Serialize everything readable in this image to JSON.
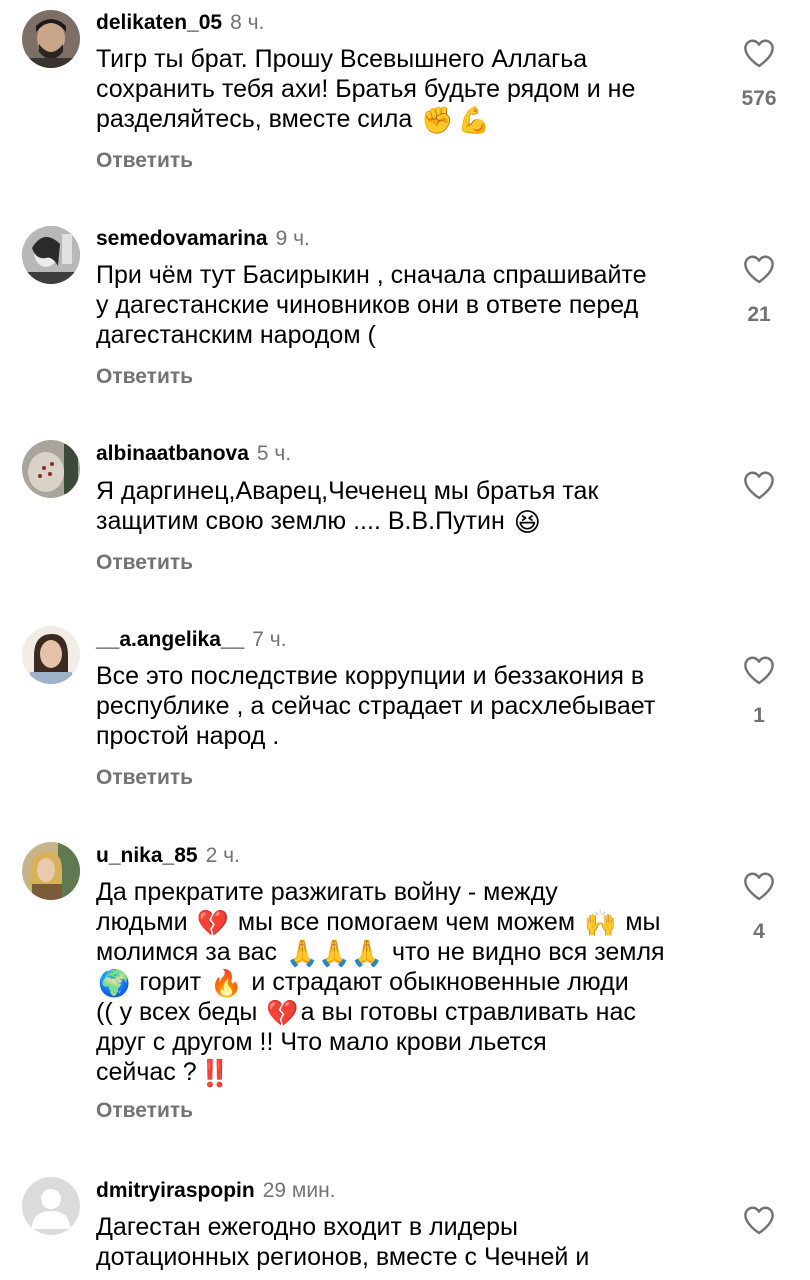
{
  "reply_label": "Ответить",
  "comments": [
    {
      "username": "delikaten_05",
      "time": "8 ч.",
      "lines": [
        "Тигр ты брат. Прошу Всевышнего Аллагьа",
        "сохранить тебя ахи! Братья будьте рядом и не",
        "разделяйтесь, вместе сила"
      ],
      "emojis": [
        "✊",
        "💪"
      ],
      "likes": "576"
    },
    {
      "username": "semedovamarina",
      "time": "9 ч.",
      "lines": [
        "При чём тут Басирыкин , сначала спрашивайте",
        "у дагестанские чиновников  они в ответе перед",
        "дагестанским  народом ("
      ],
      "likes": "21"
    },
    {
      "username": "albinaatbanova",
      "time": "5 ч.",
      "lines": [
        "Я даргинец,Аварец,Чеченец  мы братья так",
        "защитим свою землю .... В.В.Путин"
      ],
      "emojis": [
        "😆"
      ],
      "likes": ""
    },
    {
      "username": "__a.angelika__",
      "time": "7 ч.",
      "lines": [
        "Все это последствие коррупции и беззакония в",
        "республике , а сейчас страдает и расхлебывает",
        "простой народ ."
      ],
      "likes": "1"
    },
    {
      "username": "u_nika_85",
      "time": "2 ч.",
      "text": {
        "l1": "Да прекратите разжигать войну - между",
        "l2a": "людьми",
        "l2b": "мы все помогаем чем можем",
        "l2c": "мы",
        "l3a": "молимся за вас",
        "l3b": "что не видно вся земля",
        "l4a": "горит",
        "l4b": "и страдают обыкновенные люди",
        "l5a": "(( у всех беды",
        "l5b": "а вы готовы стравливать нас",
        "l6": "друг с другом !! Что мало крови льется",
        "l7": "сейчас ?"
      },
      "emojis": {
        "broken_heart": "💔",
        "raised_hands": "🙌",
        "pray": "🙏🙏🙏",
        "globe": "🌍",
        "fire": "🔥",
        "double_exclamation": "‼️"
      },
      "likes": "4"
    },
    {
      "username": "dmitryiraspopin",
      "time": "29 мин.",
      "lines": [
        "Дагестан ежегодно входит в лидеры",
        "дотационных регионов, вместе с Чечней и"
      ],
      "likes": ""
    }
  ],
  "colors": {
    "secondary_text": "#737373",
    "primary_text": "#000000",
    "background": "#ffffff"
  }
}
